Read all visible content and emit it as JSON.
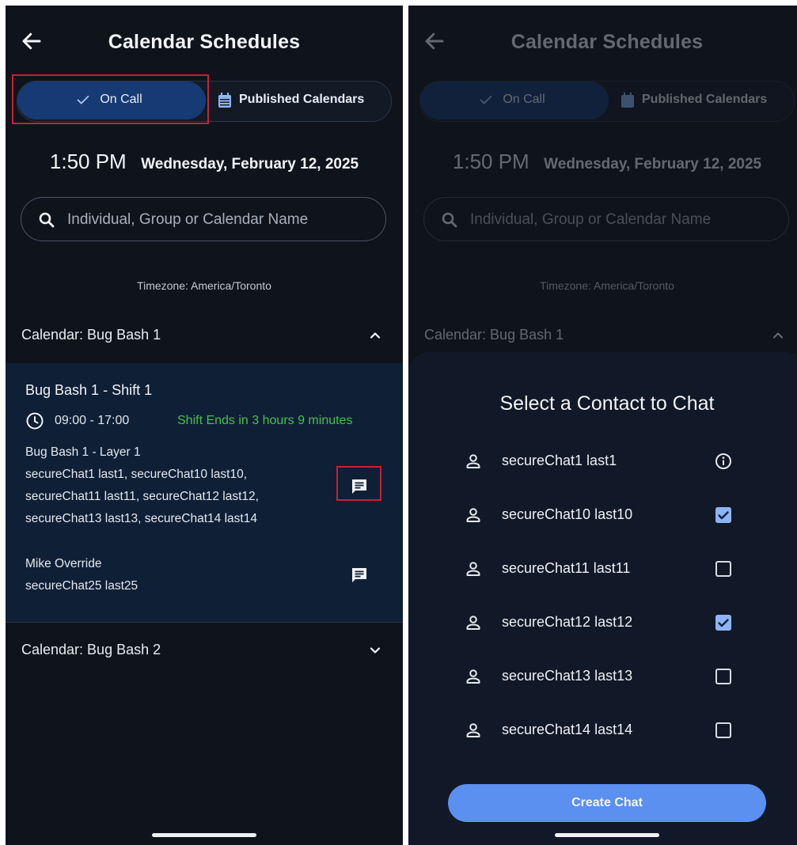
{
  "left": {
    "header": {
      "title": "Calendar Schedules"
    },
    "tabs": {
      "on_call": "On Call",
      "published": "Published Calendars"
    },
    "time": "1:50 PM",
    "date": "Wednesday, February 12, 2025",
    "search": {
      "placeholder": "Individual, Group or Calendar Name"
    },
    "timezone": "Timezone: America/Toronto",
    "calendars": [
      {
        "title": "Calendar: Bug Bash 1",
        "expanded": true
      },
      {
        "title": "Calendar: Bug Bash 2",
        "expanded": false
      }
    ],
    "shift": {
      "title": "Bug Bash 1 - Shift 1",
      "time_range": "09:00 - 17:00",
      "ends": "Shift Ends in 3 hours 9 minutes",
      "layer": {
        "name": "Bug Bash 1 - Layer 1",
        "lines": [
          "secureChat1 last1, secureChat10 last10,",
          "secureChat11 last11, secureChat12 last12,",
          "secureChat13 last13, secureChat14 last14"
        ]
      },
      "override": {
        "name": "Mike Override",
        "member": "secureChat25 last25"
      }
    }
  },
  "right": {
    "sheet": {
      "title": "Select a Contact to Chat",
      "contacts": [
        {
          "name": "secureChat1 last1",
          "control": "info"
        },
        {
          "name": "secureChat10 last10",
          "control": "checkbox",
          "checked": true
        },
        {
          "name": "secureChat11 last11",
          "control": "checkbox",
          "checked": false
        },
        {
          "name": "secureChat12 last12",
          "control": "checkbox",
          "checked": true
        },
        {
          "name": "secureChat13 last13",
          "control": "checkbox",
          "checked": false
        },
        {
          "name": "secureChat14 last14",
          "control": "checkbox",
          "checked": false
        }
      ],
      "create_label": "Create Chat"
    }
  },
  "colors": {
    "background": "#0f131b",
    "accent_tab": "#163a73",
    "shift_panel": "#0f1f36",
    "shift_ends": "#41c34b",
    "checkbox_on": "#8eb4f5",
    "create_button": "#5b8ff0",
    "highlight": "#c3203a"
  },
  "icons": [
    "back-arrow-icon",
    "check-icon",
    "calendar-icon",
    "search-icon",
    "chevron-up-icon",
    "chevron-down-icon",
    "clock-icon",
    "chat-icon",
    "person-icon",
    "info-icon",
    "checkbox-checked-icon",
    "checkbox-empty-icon"
  ]
}
